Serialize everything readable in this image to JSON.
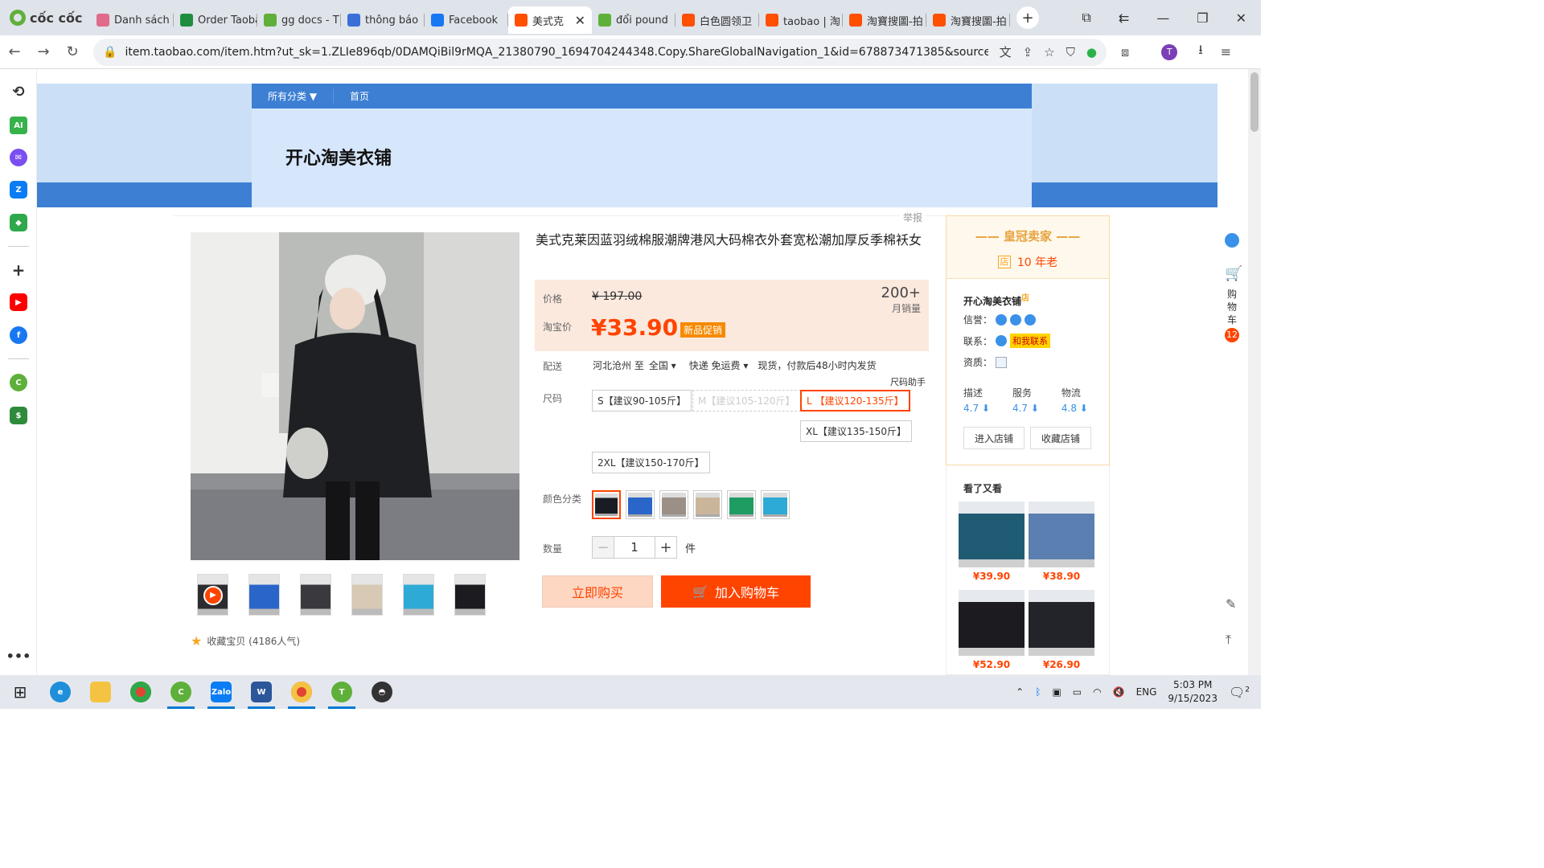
{
  "browser": {
    "brand": "cốc cốc",
    "tabs": [
      {
        "label": "Danh sách",
        "icon": "coccoc-icon",
        "color": "#e06a8a"
      },
      {
        "label": "Order Taoba",
        "icon": "sheets-icon",
        "color": "#1e8e3e"
      },
      {
        "label": "gg docs - T",
        "icon": "coccoc-icon",
        "color": "#5fb03a"
      },
      {
        "label": "thông báo",
        "icon": "docs-icon",
        "color": "#3b6fd8"
      },
      {
        "label": "Facebook",
        "icon": "facebook-icon",
        "color": "#1877f2"
      },
      {
        "label": "美式克",
        "icon": "taobao-icon",
        "color": "#ff5000",
        "active": true
      },
      {
        "label": "đổi pound",
        "icon": "coccoc-icon",
        "color": "#5fb03a"
      },
      {
        "label": "白色圆领卫",
        "icon": "taobao-icon",
        "color": "#ff5000"
      },
      {
        "label": "taobao | 淘",
        "icon": "taobao-icon",
        "color": "#ff5000"
      },
      {
        "label": "淘寶搜圖-拍",
        "icon": "taobao-icon",
        "color": "#ff5000"
      },
      {
        "label": "淘寶搜圖-拍",
        "icon": "taobao-icon",
        "color": "#ff5000"
      }
    ],
    "url": "item.taobao.com/item.htm?ut_sk=1.ZLIe896qb/0DAMQiBil9rMQA_21380790_1694704244348.Copy.ShareGlobalNavigation_1&id=678873471385&sourceType=item&sui...",
    "avatar_letter": "T"
  },
  "shop": {
    "nav": [
      "所有分类 ▼",
      "首页"
    ],
    "name": "开心淘美衣铺",
    "report": "举报"
  },
  "product": {
    "title": "美式克莱因蓝羽绒棉服潮牌港风大码棉衣外套宽松潮加厚反季棉袄女",
    "price_label": "价格",
    "orig_price": "¥ 197.00",
    "tb_label": "淘宝价",
    "tb_price": "¥33.90",
    "promo": "新品促销",
    "sales_num": "200+",
    "sales_label": "月销量",
    "ship_label": "配送",
    "ship_from": "河北沧州 至",
    "ship_to": "全国",
    "ship_type": "快递 免运费",
    "ship_note": "现货，付款后48小时内发货",
    "size_label": "尺码",
    "size_help": "尺码助手",
    "sizes": [
      {
        "label": "S【建议90-105斤】",
        "state": "normal"
      },
      {
        "label": "M【建议105-120斤】",
        "state": "disabled"
      },
      {
        "label": "L 【建议120-135斤】",
        "state": "selected"
      },
      {
        "label": "XL【建议135-150斤】",
        "state": "normal"
      },
      {
        "label": "2XL【建议150-170斤】",
        "state": "normal"
      }
    ],
    "color_label": "颜色分类",
    "swatches": [
      "#1a1c24",
      "#2a66c9",
      "#9b8f86",
      "#cbb59a",
      "#1e9d63",
      "#2eaad6"
    ],
    "qty_label": "数量",
    "qty": "1",
    "qty_unit": "件",
    "buy_now": "立即购买",
    "add_cart": "加入购物车",
    "favorite": "收藏宝贝 (4186人气)"
  },
  "seller": {
    "badge": "皇冠卖家",
    "years_icon": "店",
    "years": "10 年老",
    "name": "开心淘美衣铺",
    "name_suffix": "店",
    "rep_label": "信誉：",
    "contact_label": "联系：",
    "contact_btn": "和我联系",
    "qual_label": "资质：",
    "scores": [
      {
        "label": "描述",
        "value": "4.7 ⬇"
      },
      {
        "label": "服务",
        "value": "4.7 ⬇"
      },
      {
        "label": "物流",
        "value": "4.8 ⬇"
      }
    ],
    "enter_shop": "进入店铺",
    "fav_shop": "收藏店铺"
  },
  "also_seen": {
    "title": "看了又看",
    "items": [
      {
        "price": "¥39.90",
        "color": "#1f5b73"
      },
      {
        "price": "¥38.90",
        "color": "#5b7fb0"
      },
      {
        "price": "¥52.90",
        "color": "#1c1c20"
      },
      {
        "price": "¥26.90",
        "color": "#23232a"
      }
    ]
  },
  "right_rail": {
    "cart_label": "购物车",
    "cart_count": "12"
  },
  "taskbar": {
    "lang": "ENG",
    "time": "5:03 PM",
    "date": "9/15/2023",
    "notif": "2"
  }
}
